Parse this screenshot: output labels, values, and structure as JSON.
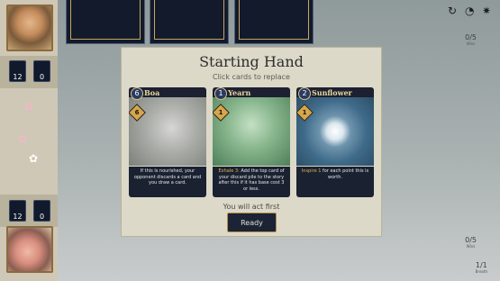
{
  "modal": {
    "title": "Starting Hand",
    "subtitle": "Click cards to replace",
    "act_first": "You will act first",
    "ready_label": "Ready"
  },
  "cards": [
    {
      "cost": "6",
      "power": "6",
      "name": "Boa",
      "text": "If this is nourished, your opponent discards a card and you draw a card.",
      "keyword": ""
    },
    {
      "cost": "1",
      "power": "1",
      "name": "Yearn",
      "keyword": "Exhale 3:",
      "text": " Add the top card of your discard pile to the story after this if it has base cost 3 or less."
    },
    {
      "cost": "2",
      "power": "1",
      "name": "Sunflower",
      "keyword": "Inspire 1",
      "text": " for each point this is worth."
    }
  ],
  "left_panel": {
    "top_deck_count": "12",
    "top_hand_count": "0",
    "bottom_deck_count": "12",
    "bottom_hand_count": "0"
  },
  "stats": {
    "opponent_wins": "0/5",
    "opponent_wins_label": "Wins",
    "player_wins": "0/5",
    "player_wins_label": "Wins",
    "breath": "1/1",
    "breath_label": "Breath"
  },
  "icons": [
    "undo-icon",
    "speed-icon",
    "settings-icon"
  ],
  "colors": {
    "card_boa_art": "#a9aba7",
    "card_yearn_art": "#86b48b",
    "card_sunflower_art": "#3f6b8a",
    "accent_gold": "#d4a64e"
  }
}
